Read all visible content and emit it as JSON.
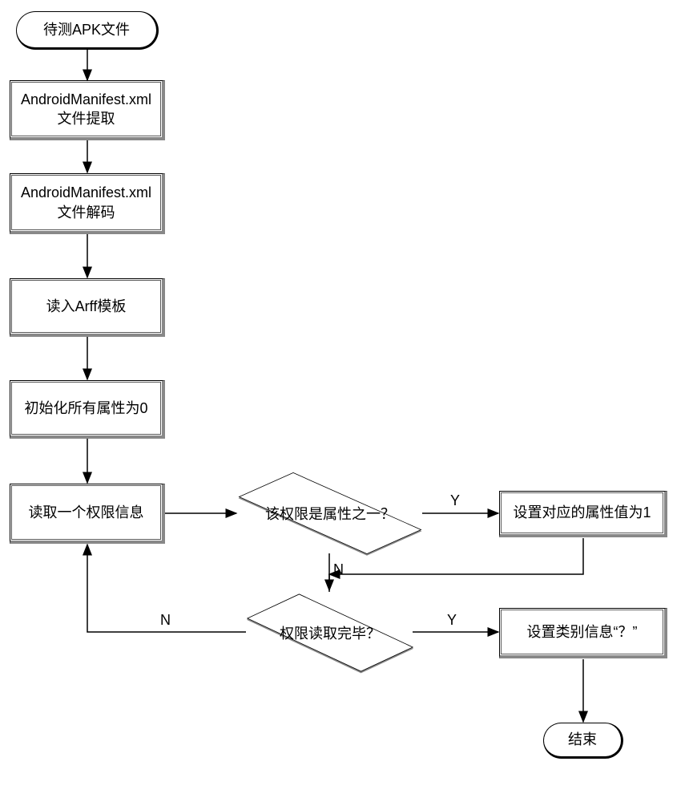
{
  "nodes": {
    "start": "待测APK文件",
    "extract": "AndroidManifest.xml\n文件提取",
    "decode": "AndroidManifest.xml\n文件解码",
    "readArff": "读入Arff模板",
    "initAttr": "初始化所有属性为0",
    "readPerm": "读取一个权限信息",
    "isAttr": "该权限是属性之一？",
    "setOne": "设置对应的属性值为1",
    "doneRead": "权限读取完毕？",
    "setCat": "设置类别信息“？”",
    "end": "结束"
  },
  "labels": {
    "y1": "Y",
    "n1": "N",
    "y2": "Y",
    "n2": "N"
  }
}
